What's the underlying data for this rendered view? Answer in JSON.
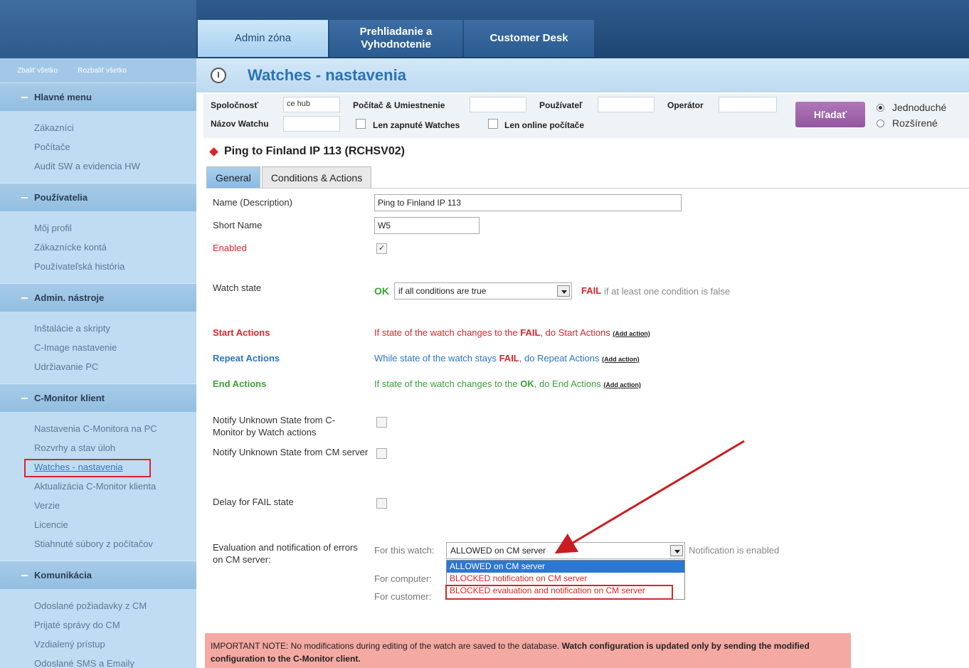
{
  "header": {
    "tabs": [
      "Admin zóna",
      "Prehliadanie a Vyhodnotenie",
      "Customer Desk"
    ]
  },
  "sidebar": {
    "collapse_all": "Zbaliť všetko",
    "expand_all": "Rozbaliť všetko",
    "sections": [
      {
        "title": "Hlavné menu",
        "items": [
          "Zákazníci",
          "Počítače",
          "Audit SW a evidencia HW"
        ]
      },
      {
        "title": "Používatelia",
        "items": [
          "Môj profil",
          "Zákaznícke kontá",
          "Používateľská história"
        ]
      },
      {
        "title": "Admin. nástroje",
        "items": [
          "Inštalácie a skripty",
          "C-Image nastavenie",
          "Udržiavanie PC"
        ]
      },
      {
        "title": "C-Monitor klient",
        "items": [
          "Nastavenia C-Monitora na PC",
          "Rozvrhy a stav úloh",
          "Watches - nastavenia",
          "Aktualizácia C-Monitor klienta",
          "Verzie",
          "Licencie",
          "Stiahnuté súbory z počítačov"
        ]
      },
      {
        "title": "Komunikácia",
        "items": [
          "Odoslané požiadavky z CM",
          "Prijaté správy do CM",
          "Vzdialený prístup",
          "Odoslané SMS a Emaily"
        ]
      }
    ],
    "active_item": "Watches - nastavenia"
  },
  "page": {
    "title": "Watches - nastavenia"
  },
  "search": {
    "company_label": "Spoločnosť",
    "company_value": "ce hub",
    "computer_label": "Počítač & Umiestnenie",
    "user_label": "Používateľ",
    "operator_label": "Operátor",
    "watch_name_label": "Názov Watchu",
    "only_enabled_label": "Len zapnuté Watches",
    "only_online_label": "Len online počítače",
    "search_button": "Hľadať",
    "mode_simple": "Jednoduché",
    "mode_advanced": "Rozšírené"
  },
  "watch": {
    "heading": "Ping to Finland IP 113 (RCHSV02)",
    "tabs": [
      "General",
      "Conditions & Actions"
    ],
    "name_label": "Name (Description)",
    "name_value": "Ping to Finland IP 113",
    "short_name_label": "Short Name",
    "short_name_value": "W5",
    "enabled_label": "Enabled",
    "enabled_mark": "✓",
    "state_label": "Watch state",
    "state_ok": "OK",
    "state_select": "if all conditions are true",
    "state_fail": "FAIL",
    "state_fail_text": "if at least one condition is false",
    "start_label": "Start Actions",
    "start_text_1": "If state of the watch changes to the ",
    "start_fail": "FAIL",
    "start_text_2": ", do Start Actions ",
    "repeat_label": "Repeat Actions",
    "repeat_text_1": "While state of the watch stays ",
    "repeat_fail": "FAIL",
    "repeat_text_2": ", do Repeat Actions ",
    "end_label": "End Actions",
    "end_text_1": "If state of the watch changes to the ",
    "end_ok": "OK",
    "end_text_2": ", do End Actions ",
    "add_action": "(Add action)",
    "notify_watch_label": "Notify Unknown State from C-Monitor by Watch actions",
    "notify_cm_label": "Notify Unknown State from CM server",
    "delay_label": "Delay for FAIL state",
    "eval_label": "Evaluation and notification of errors on CM server:",
    "for_watch": "For this watch:",
    "for_watch_value": "ALLOWED on CM server",
    "notification_status": "Notification is enabled",
    "for_computer": "For computer:",
    "for_customer": "For customer:",
    "dropdown_options": [
      "ALLOWED on CM server",
      "BLOCKED notification on CM server",
      "BLOCKED evaluation and notification on CM server"
    ]
  },
  "note": {
    "text_normal": "IMPORTANT NOTE: No modifications during editing of the watch are saved to the database. ",
    "text_bold": "Watch configuration is updated only by sending the modified configuration to the C-Monitor client."
  },
  "colors": {
    "accent_blue": "#2a73b6",
    "fail_red": "#d8262b",
    "ok_green": "#3aa138",
    "search_button": "#9456a0"
  }
}
